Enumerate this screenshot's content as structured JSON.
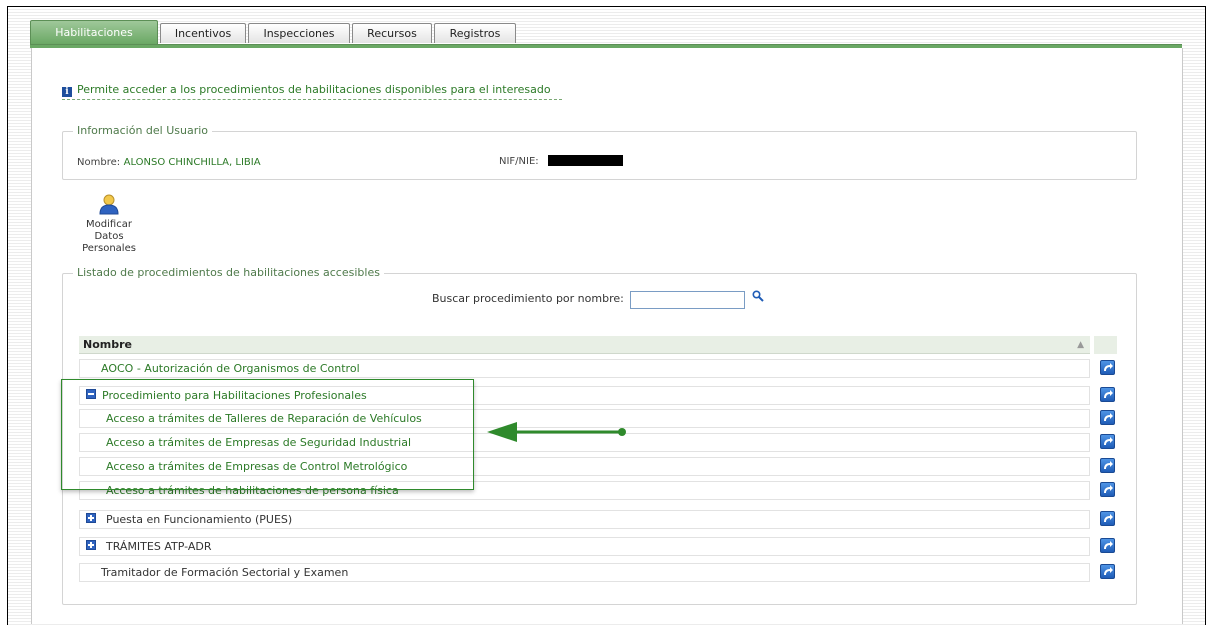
{
  "tabs": [
    "Habilitaciones",
    "Incentivos",
    "Inspecciones",
    "Recursos",
    "Registros"
  ],
  "info_text": "Permite acceder a los procedimientos de habilitaciones disponibles para el interesado",
  "user_info": {
    "legend": "Información del Usuario",
    "name_label": "Nombre:",
    "name_value": "ALONSO CHINCHILLA, LIBIA",
    "nif_label": "NIF/NIE:"
  },
  "modify": {
    "line1": "Modificar",
    "line2": "Datos",
    "line3": "Personales"
  },
  "list": {
    "legend": "Listado de procedimientos de habilitaciones accesibles",
    "search_label": "Buscar procedimiento por nombre:",
    "search_value": "",
    "column_header": "Nombre",
    "rows": [
      {
        "label": "AOCO - Autorización de Organismos de Control"
      },
      {
        "label": "Procedimiento para Habilitaciones Profesionales"
      },
      {
        "label": "Acceso a trámites de Talleres de Reparación de Vehículos"
      },
      {
        "label": "Acceso a trámites de Empresas de Seguridad Industrial"
      },
      {
        "label": "Acceso a trámites de Empresas de Control Metrológico"
      },
      {
        "label": "Acceso a trámites de habilitaciones de persona física"
      },
      {
        "label": "Puesta en Funcionamiento (PUES)"
      },
      {
        "label": "TRÁMITES ATP-ADR"
      },
      {
        "label": "Tramitador de Formación Sectorial y Examen"
      }
    ]
  },
  "colors": {
    "accent_green": "#2c7a27",
    "tab_green": "#6aa864",
    "button_blue": "#2f63c0",
    "annotation_green": "#2f8a2c"
  }
}
